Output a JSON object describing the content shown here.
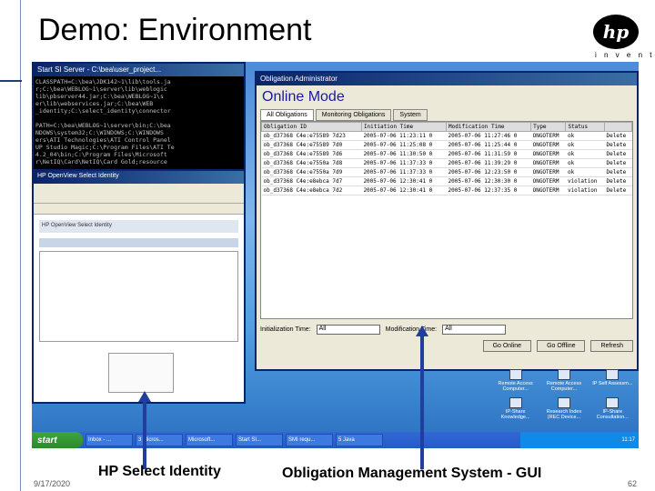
{
  "slide": {
    "title": "Demo: Environment",
    "date": "9/17/2020",
    "page": "62",
    "captions": {
      "left": "HP Select Identity",
      "right": "Obligation Management System - GUI"
    }
  },
  "logo": {
    "mark": "hp",
    "tagline": "i n v e n t"
  },
  "console": {
    "title": "Start SI Server - C:\\bea\\user_project...",
    "lines": [
      "CLASSPATH=C:\\bea\\JDK142~1\\lib\\tools.ja",
      "r;C:\\bea\\WEBLOG~1\\server\\lib\\weblogic",
      "lib\\pbserver44.jar;C:\\bea\\WEBLOG~1\\s",
      "er\\lib\\webservices.jar;C:\\bea\\WEB",
      "_identity;C:\\select_identity\\connector",
      "",
      "PATH=C:\\bea\\WEBLOG~1\\server\\bin;C:\\bea",
      "NDOWS\\system32;C:\\WINDOWS;C:\\WINDOWS",
      "ers\\ATI Technologies\\ATI Control Panel",
      "UP Studio Magic;C:\\Program Files\\ATI Te",
      "4.2_04\\bin;C:\\Program Files\\Microsoft",
      "r\\NetIQ\\Card\\NetIQ\\Card Gold;resource"
    ]
  },
  "browser": {
    "title": "HP OpenView Select Identity",
    "banner": "HP OpenView Select Identity"
  },
  "obligation_window": {
    "title": "Obligation Administrator",
    "mode": "Online Mode",
    "tabs": [
      "All Obligations",
      "Monitoring Obligations",
      "System"
    ],
    "columns": [
      "Obligation ID",
      "Initiation Time",
      "Modification Time",
      "Type",
      "Status",
      ""
    ],
    "rows": [
      [
        "ob_d37368 C4e:e75589 7d23",
        "2005-07-06 11:23:11 0",
        "2005-07-06 11:27:46 0",
        "ONGOTERM",
        "ok",
        "Delete"
      ],
      [
        "ob_d37368 C4e:e75589 7d0",
        "2005-07-06 11:25:08 0",
        "2005-07-06 11:25:44 0",
        "ONGOTERM",
        "ok",
        "Delete"
      ],
      [
        "ob_d37368 C4e:e75589 7d6",
        "2005-07-06 11:30:50 0",
        "2005-07-06 11:31:59 0",
        "ONGOTERM",
        "ok",
        "Delete"
      ],
      [
        "ob_d37368 C4e:e7550a 7d8",
        "2005-07-06 11:37:33 0",
        "2005-07-06 11:39:29 0",
        "ONGOTERM",
        "ok",
        "Delete"
      ],
      [
        "ob_d37368 C4e:e7550a 7d9",
        "2005-07-06 11:37:33 0",
        "2005-07-06 12:23:50 0",
        "ONGOTERM",
        "ok",
        "Delete"
      ],
      [
        "ob_d37368 C4e:e8ebca 7d7",
        "2005-07-06 12:30:41 0",
        "2005-07-06 12:30:30 0",
        "ONGOTERM",
        "violation",
        "Delete"
      ],
      [
        "ob_d37368 C4e:e8ebca 7d2",
        "2005-07-06 12:30:41 0",
        "2005-07-06 12:37:35 0",
        "ONGOTERM",
        "violation",
        "Delete"
      ]
    ],
    "filters": {
      "init_label": "Initialization Time:",
      "init_value": "All",
      "mod_label": "Modification Time:",
      "mod_value": "All"
    },
    "buttons": [
      "Go Online",
      "Go Offline",
      "Refresh"
    ]
  },
  "desktop_icons": [
    "Remote Access Computer...",
    "Remote Access Computer...",
    "IP Self Assessm...",
    "IP-Share Knowledge...",
    "Research Index (REC Device...",
    "IP-Share Consultation..."
  ],
  "taskbar": {
    "start": "start",
    "tasks": [
      "Inbox - ...",
      "3 Micros...",
      "Microsoft...",
      "Start SI...",
      "SMI requ...",
      "5 Java"
    ],
    "clock": "11:17"
  },
  "colors": {
    "title_bar": "#0a246a",
    "taskbar": "#245bc9",
    "start": "#2b8a2b",
    "online_mode": "#1a1aa0"
  }
}
